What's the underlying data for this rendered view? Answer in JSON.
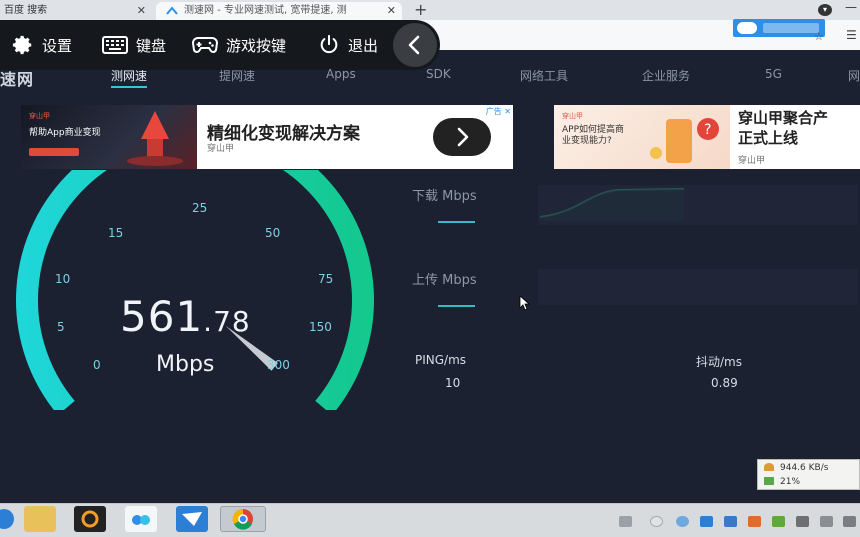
{
  "browser": {
    "tabs": [
      {
        "label": "百度 搜索"
      },
      {
        "label": "测速网 - 专业网速测试, 宽带提速, 测"
      }
    ],
    "new_tab": "+",
    "close_glyph": "✕"
  },
  "overlay": {
    "items": [
      {
        "label": "设置",
        "icon": "gear-icon"
      },
      {
        "label": "键盘",
        "icon": "keyboard-icon"
      },
      {
        "label": "游戏按键",
        "icon": "gamepad-icon"
      },
      {
        "label": "退出",
        "icon": "power-icon"
      }
    ],
    "back_icon": "chevron-left-icon"
  },
  "site": {
    "logo_fragment": "速网",
    "nav": [
      {
        "label": "测网速",
        "active": true
      },
      {
        "label": "提网速"
      },
      {
        "label": "Apps"
      },
      {
        "label": "SDK"
      },
      {
        "label": "网络工具"
      },
      {
        "label": "企业服务"
      },
      {
        "label": "5G"
      },
      {
        "label": "网"
      }
    ]
  },
  "ads": [
    {
      "brand": "穿山甲",
      "img_text": "帮助App商业变现",
      "title": "精细化变现解决方案",
      "sub": "穿山甲",
      "close": "广告 ✕"
    },
    {
      "brand": "穿山甲",
      "img_text": "APP如何提高商业变现能力?",
      "title_line1": "穿山甲聚合产",
      "title_line2": "正式上线",
      "sub": "穿山甲"
    }
  ],
  "gauge": {
    "value_int": "561",
    "value_dec": ".78",
    "unit": "Mbps",
    "ticks": [
      "0",
      "5",
      "10",
      "15",
      "25",
      "50",
      "75",
      "150",
      "300"
    ],
    "reading": 561.78,
    "scale_max": 300
  },
  "metrics": {
    "download_label": "下载 Mbps",
    "upload_label": "上传 Mbps",
    "ping_label": "PING/ms",
    "ping_value": "10",
    "jitter_label": "抖动/ms",
    "jitter_value": "0.89"
  },
  "netmon": {
    "speed": "944.6 KB/s",
    "cpu": "21%"
  },
  "colors": {
    "accent": "#34c6d8",
    "background": "#1b2130",
    "gauge_start": "#1fd6d8",
    "gauge_end": "#14c88e"
  }
}
